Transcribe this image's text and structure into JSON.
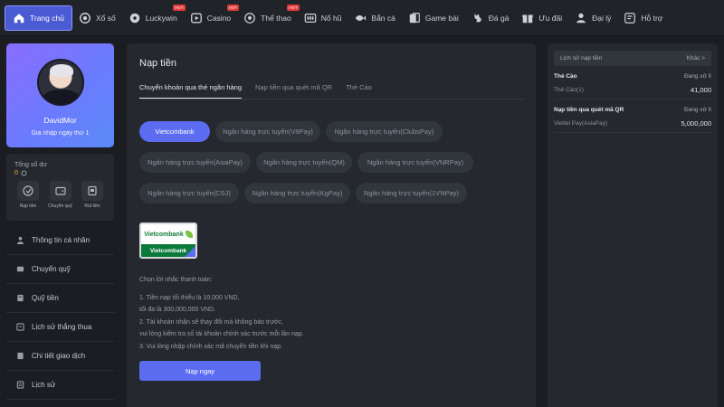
{
  "nav": {
    "items": [
      {
        "label": "Trang chủ",
        "icon": "home-icon",
        "active": true
      },
      {
        "label": "Xổ số",
        "icon": "lottery-icon"
      },
      {
        "label": "Luckywin",
        "icon": "luckywin-icon",
        "badge": "HOT"
      },
      {
        "label": "Casino",
        "icon": "casino-icon",
        "badge": "HOT"
      },
      {
        "label": "Thể thao",
        "icon": "soccer-ball-icon",
        "badge": "HOT"
      },
      {
        "label": "Nổ hũ",
        "icon": "slot-icon"
      },
      {
        "label": "Bắn cá",
        "icon": "fish-icon"
      },
      {
        "label": "Game bài",
        "icon": "cards-icon"
      },
      {
        "label": "Đá gà",
        "icon": "rooster-icon"
      },
      {
        "label": "Ưu đãi",
        "icon": "gift-icon"
      },
      {
        "label": "Đại lý",
        "icon": "agent-icon"
      },
      {
        "label": "Hỗ trợ",
        "icon": "support-icon"
      }
    ]
  },
  "profile": {
    "username": "DavidMor",
    "joined": "Gia nhập ngày thứ 1"
  },
  "balance": {
    "label": "Tổng số dư",
    "value": "0",
    "actions": [
      {
        "label": "Nạp tiền",
        "icon": "deposit-icon"
      },
      {
        "label": "Chuyển quỹ",
        "icon": "wallet-icon"
      },
      {
        "label": "Rút tiền",
        "icon": "withdraw-icon"
      }
    ]
  },
  "menu": [
    {
      "label": "Thông tin cá nhân",
      "icon": "user-icon"
    },
    {
      "label": "Chuyển quỹ",
      "icon": "wallet-icon"
    },
    {
      "label": "Quỹ tiền",
      "icon": "fund-icon"
    },
    {
      "label": "Lịch sử thắng thua",
      "icon": "history-icon"
    },
    {
      "label": "Chi tiết giao dịch",
      "icon": "transactions-icon"
    },
    {
      "label": "Lịch sử",
      "icon": "list-icon"
    }
  ],
  "main": {
    "title": "Nạp tiền",
    "tabs": [
      {
        "label": "Chuyển khoản qua thẻ ngân hàng",
        "active": true
      },
      {
        "label": "Nạp tiền qua quét mã QR",
        "active": false
      },
      {
        "label": "Thẻ Cào",
        "active": false
      }
    ],
    "bank_rows": [
      [
        {
          "label": "Vietcombank",
          "active": true
        },
        {
          "label": "Ngân hàng trực tuyến(V8Pay)"
        },
        {
          "label": "Ngân hàng trực tuyến(ClubsPay)"
        }
      ],
      [
        {
          "label": "Ngân hàng trực tuyến(AsiaPay)"
        },
        {
          "label": "Ngân hàng trực tuyến(QM)"
        },
        {
          "label": "Ngân hàng trực tuyến(VNRPay)"
        }
      ],
      [
        {
          "label": "Ngân hàng trực tuyến(CSJ)"
        },
        {
          "label": "Ngân hàng trực tuyến(KgPay)"
        },
        {
          "label": "Ngân hàng trực tuyến(1VNPay)"
        }
      ]
    ],
    "bank_card": {
      "logo_text": "Vietcombank",
      "label": "Vietcombank"
    },
    "notes": {
      "heading": "Chọn lời nhắc thanh toán:",
      "lines": [
        "1. Tiền nạp tối thiểu là 10,000 VND,",
        "tối đa là 300,000,000 VND.",
        "2. Tài khoản nhận sẽ thay đổi mà không báo trước,",
        "vui lòng kiểm tra số tài khoản chính xác trước mỗi lần nạp.",
        "3. Vui lòng nhập chính xác mã chuyển tiền khi nạp."
      ]
    },
    "submit_label": "Nạp ngay"
  },
  "history": {
    "title": "Lịch sử nạp tiền",
    "more": "Khác >",
    "entries": [
      {
        "method": "Thẻ Cào",
        "status": "Đang xử lí",
        "detail": "Thẻ Cào(1)",
        "amount": "41,000"
      },
      {
        "method": "Nạp tiền qua quét mã QR",
        "status": "Đang xử lí",
        "detail": "Viettel Pay(AsiaPay)",
        "amount": "5,000,000"
      }
    ]
  },
  "colors": {
    "accent": "#5b6cf0",
    "background": "#1b1d22",
    "panel": "#25282e",
    "balance": "#f2b63c"
  }
}
